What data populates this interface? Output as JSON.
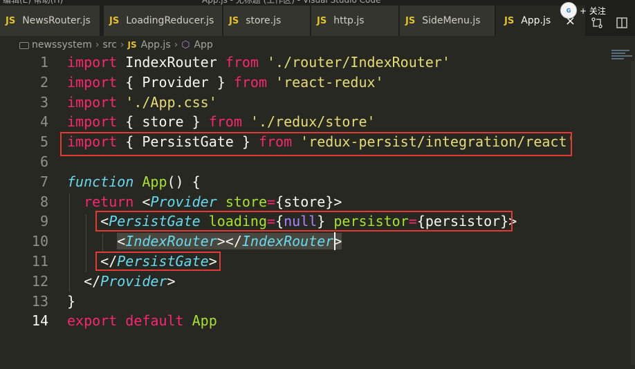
{
  "window": {
    "menu": "编辑(E)    帮助(H)",
    "title": "App.js - 无标题 (工作区) - Visual Studio Code"
  },
  "tabs": [
    {
      "label": "NewsRouter.js",
      "icon": "JS",
      "active": false
    },
    {
      "label": "LoadingReducer.js",
      "icon": "JS",
      "active": false
    },
    {
      "label": "store.js",
      "icon": "JS",
      "active": false
    },
    {
      "label": "http.js",
      "icon": "JS",
      "active": false
    },
    {
      "label": "SideMenu.js",
      "icon": "JS",
      "active": false
    },
    {
      "label": "App.js",
      "icon": "JS",
      "active": true,
      "close": "×"
    }
  ],
  "follow": {
    "label": "+ 关注",
    "avatar": "G"
  },
  "editor_actions": {
    "compare_icon": "git-compare-icon",
    "split_icon": "split-editor-icon"
  },
  "breadcrumb": {
    "folder": "newssystem",
    "sub": "src",
    "file": "App.js",
    "file_icon": "JS",
    "symbol": "App",
    "separator": "›"
  },
  "code": {
    "line_numbers": [
      "1",
      "2",
      "3",
      "4",
      "5",
      "6",
      "7",
      "8",
      "9",
      "10",
      "11",
      "12",
      "13",
      "14"
    ],
    "current_line": "14"
  },
  "annotation_color": "#e53935"
}
